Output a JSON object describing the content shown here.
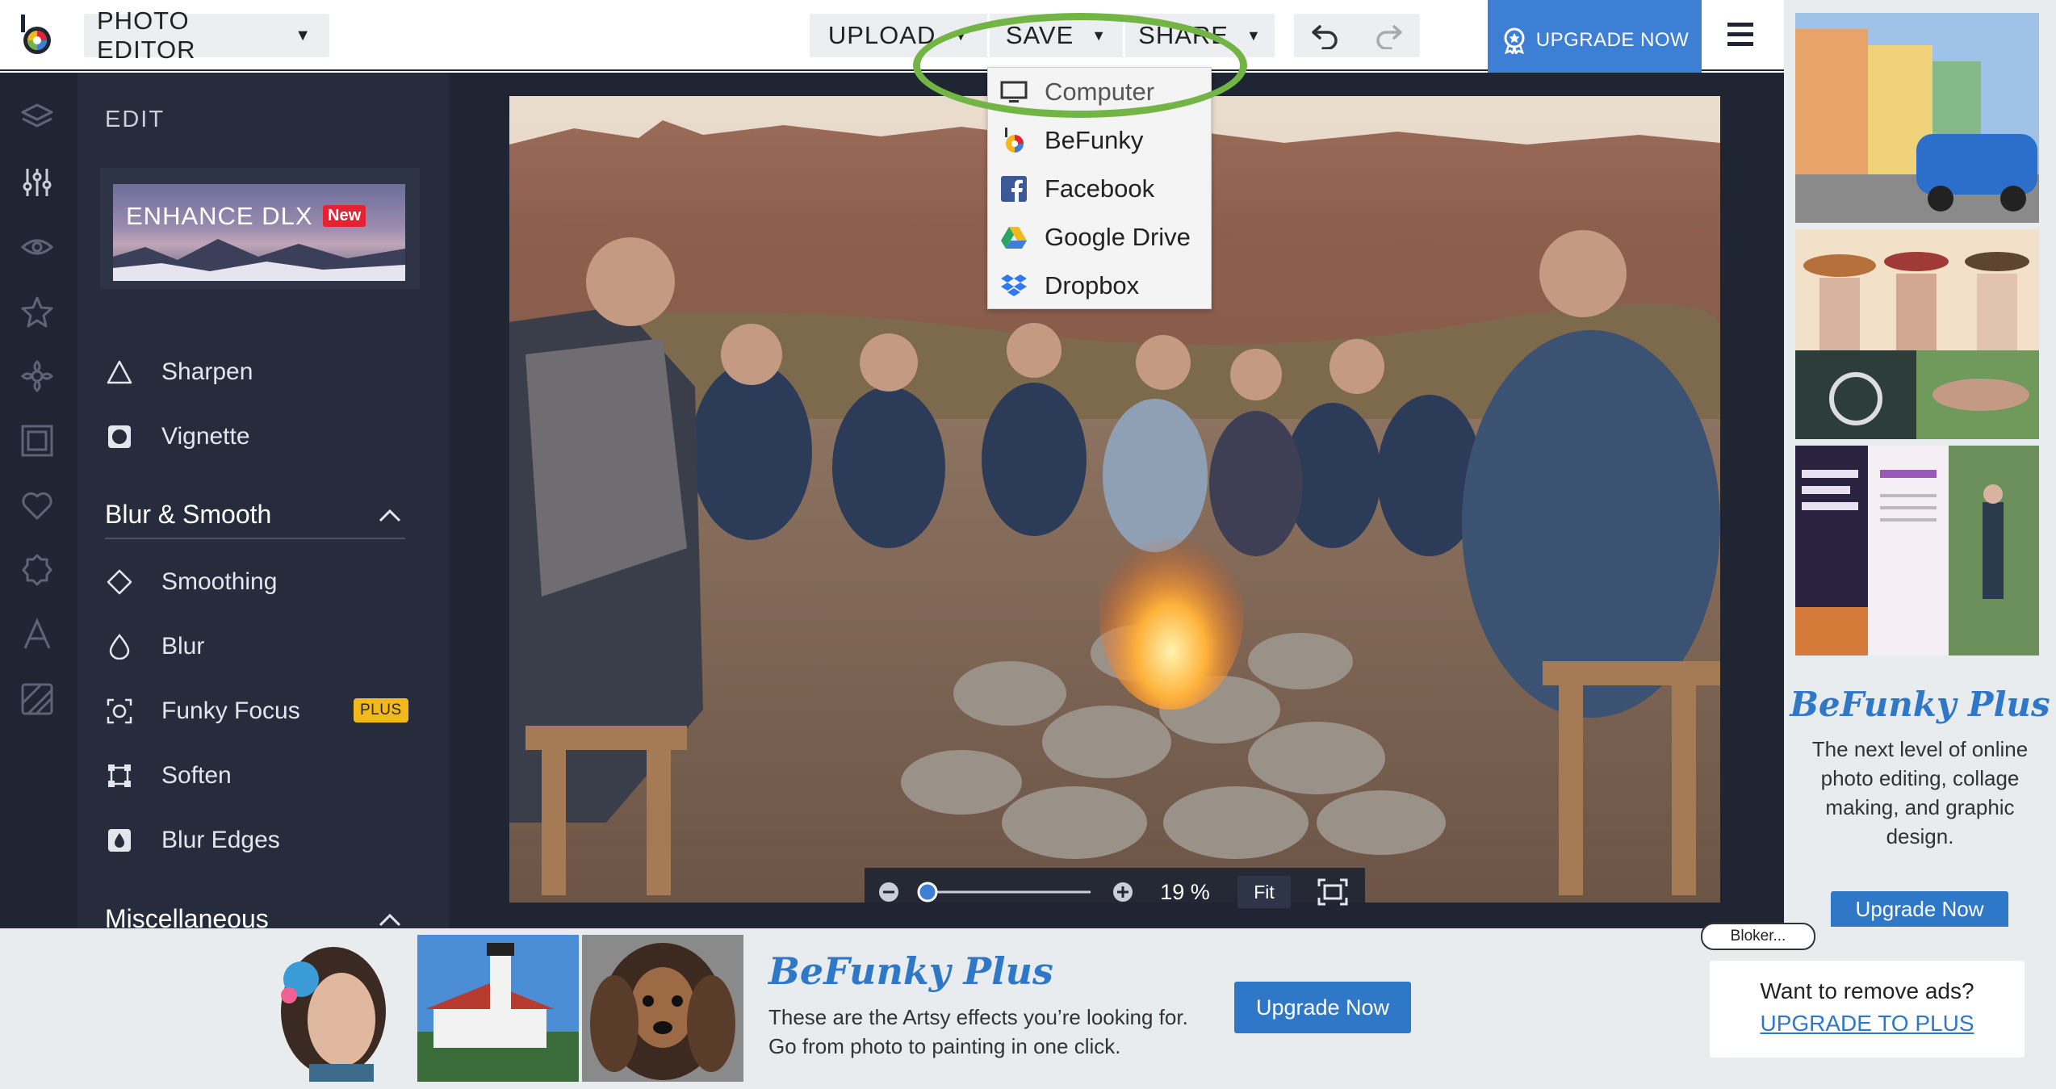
{
  "header": {
    "editor_select": "PHOTO EDITOR",
    "upload": "UPLOAD",
    "save": "SAVE",
    "share": "SHARE",
    "upgrade": "UPGRADE NOW"
  },
  "save_menu": {
    "items": [
      {
        "label": "Computer",
        "icon": "monitor-icon"
      },
      {
        "label": "BeFunky",
        "icon": "befunky-logo-icon"
      },
      {
        "label": "Facebook",
        "icon": "facebook-icon"
      },
      {
        "label": "Google Drive",
        "icon": "google-drive-icon"
      },
      {
        "label": "Dropbox",
        "icon": "dropbox-icon"
      }
    ]
  },
  "rail": {
    "icons": [
      "layers-icon",
      "sliders-icon",
      "eye-icon",
      "star-icon",
      "flower-icon",
      "frame-icon",
      "heart-icon",
      "badge-icon",
      "text-icon",
      "texture-icon"
    ]
  },
  "panel": {
    "title": "EDIT",
    "enhance": {
      "label": "ENHANCE DLX",
      "badge": "New"
    },
    "tools_top": [
      {
        "label": "Sharpen",
        "icon": "triangle-icon"
      },
      {
        "label": "Vignette",
        "icon": "vignette-icon"
      }
    ],
    "blur_section": {
      "title": "Blur & Smooth",
      "tools": [
        {
          "label": "Smoothing",
          "icon": "diamond-icon"
        },
        {
          "label": "Blur",
          "icon": "drop-icon"
        },
        {
          "label": "Funky Focus",
          "icon": "focus-icon",
          "badge": "PLUS"
        },
        {
          "label": "Soften",
          "icon": "soften-icon"
        },
        {
          "label": "Blur Edges",
          "icon": "blur-edges-icon"
        }
      ]
    },
    "misc_section": {
      "title": "Miscellaneous"
    }
  },
  "zoom": {
    "percent": "19 %",
    "fit": "Fit"
  },
  "right_ad": {
    "brand": "BeFunky Plus",
    "text": "The next level of online photo editing, collage making, and graphic design.",
    "button": "Upgrade Now"
  },
  "bottom_ad": {
    "brand": "BeFunky Plus",
    "line1": "These are the Artsy effects you’re looking for.",
    "line2": "Go from photo to painting in one click.",
    "button": "Upgrade Now",
    "bloker": "Bloker...",
    "remove_question": "Want to remove ads?",
    "remove_link": "UPGRADE TO PLUS"
  },
  "colors": {
    "accent_blue": "#3e7fd6",
    "dark_bg": "#1f2533",
    "panel_bg": "#262c3b",
    "highlight_green": "#73b544",
    "plus_badge": "#f2b91d",
    "new_badge": "#e52234"
  }
}
